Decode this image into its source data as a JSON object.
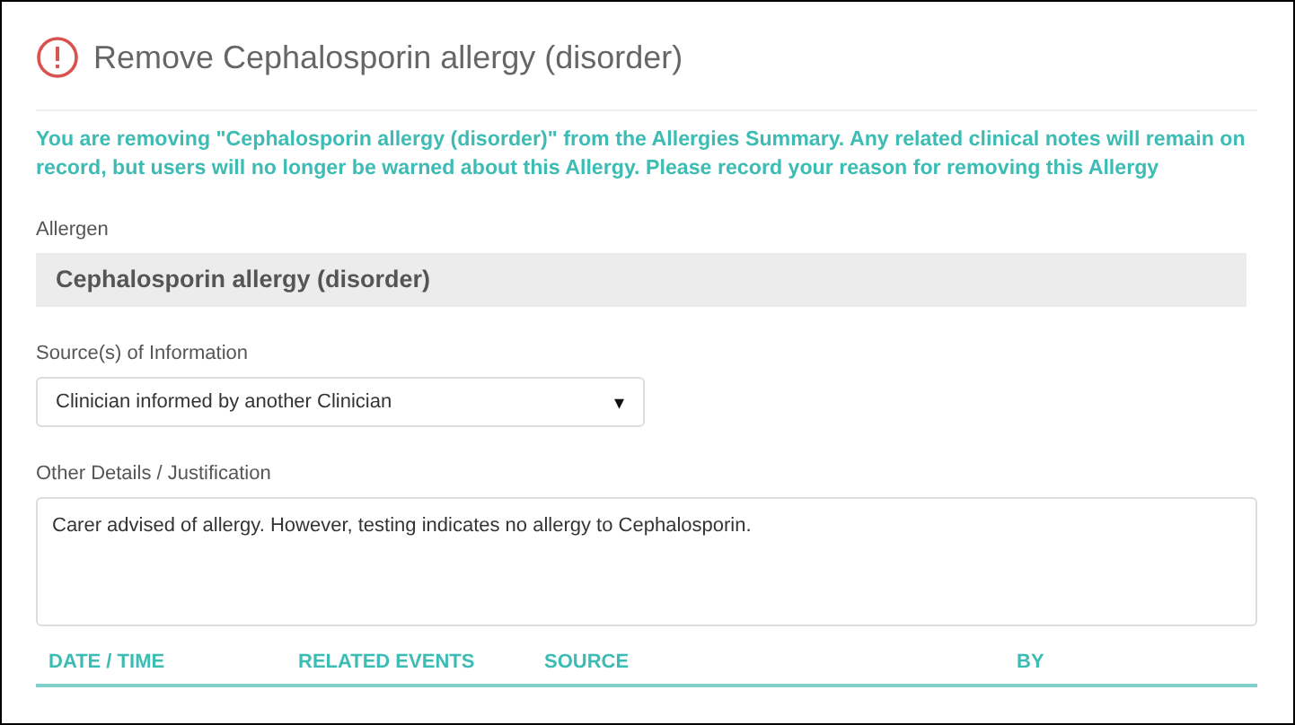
{
  "dialog": {
    "title": "Remove Cephalosporin allergy (disorder)"
  },
  "notice": "You are removing \"Cephalosporin allergy (disorder)\" from the Allergies Summary. Any related clinical notes will remain on record, but users will no longer be warned about this Allergy. Please record your reason for removing this Allergy",
  "allergen": {
    "label": "Allergen",
    "value": "Cephalosporin allergy (disorder)"
  },
  "source": {
    "label": "Source(s) of Information",
    "value": "Clinician informed by another Clinician",
    "arrow": "▾"
  },
  "details": {
    "label": "Other Details / Justification",
    "value": "Carer advised of allergy. However, testing indicates no allergy to Cephalosporin."
  },
  "table": {
    "columns": [
      "DATE / TIME",
      "RELATED EVENTS",
      "SOURCE",
      "BY"
    ]
  }
}
